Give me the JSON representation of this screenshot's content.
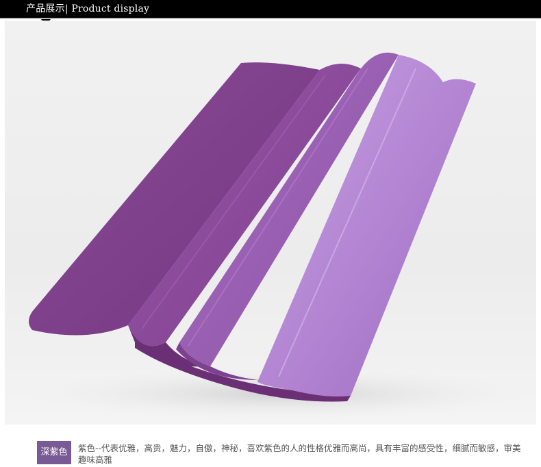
{
  "header": {
    "title": "产品展示| Product display"
  },
  "photo": {
    "subject_icon": "yoga-mat-photo",
    "mat_color_dark": "#7a3f86",
    "mat_color_light": "#b58ad6"
  },
  "caption": {
    "badge": "深紫色",
    "text": "紫色--代表优雅，高贵，魅力，自傲，神秘，喜欢紫色的人的性格优雅而高尚，具有丰富的感受性，细腻而敏感，审美趣味高雅",
    "badge_color": "#7a5a94"
  }
}
